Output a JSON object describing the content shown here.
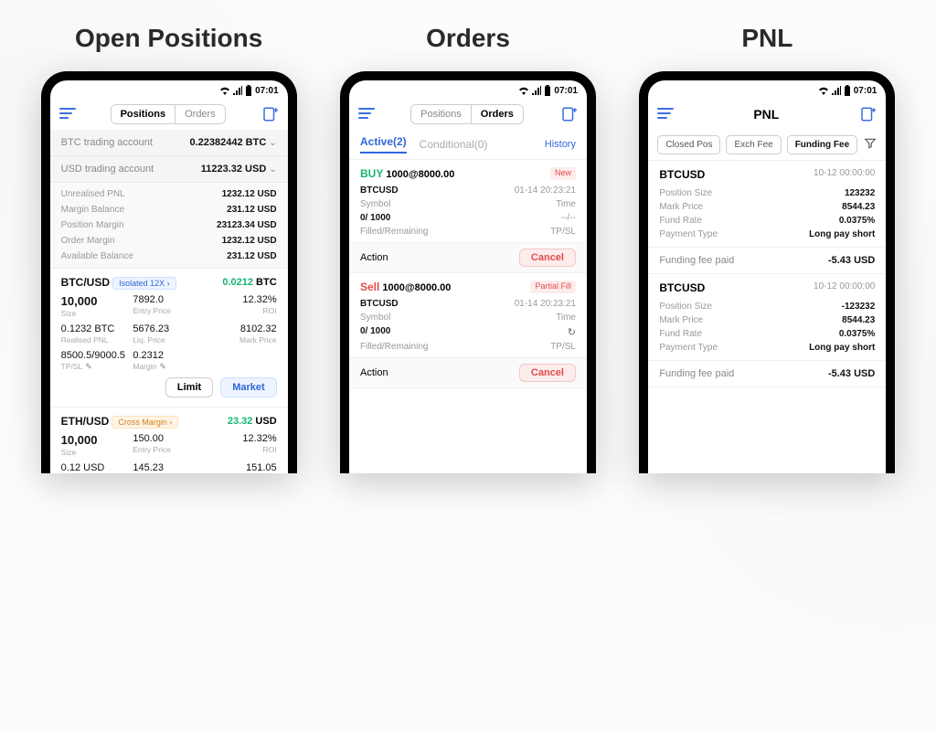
{
  "status_time": "07:01",
  "panels": {
    "positions": {
      "title": "Open Positions"
    },
    "orders": {
      "title": "Orders"
    },
    "pnl": {
      "title": "PNL"
    }
  },
  "header_tabs": {
    "positions": "Positions",
    "orders": "Orders"
  },
  "pnl_header_title": "PNL",
  "positions": {
    "accounts": {
      "btc": {
        "label": "BTC trading account",
        "value": "0.22382442 BTC"
      },
      "usd": {
        "label": "USD trading account",
        "value": "11223.32 USD"
      }
    },
    "summary": {
      "unrealised_pnl": {
        "k": "Unrealised PNL",
        "v": "1232.12 USD"
      },
      "margin_balance": {
        "k": "Margin Balance",
        "v": "231.12 USD"
      },
      "position_margin": {
        "k": "Position Margin",
        "v": "23123.34 USD"
      },
      "order_margin": {
        "k": "Order Margin",
        "v": "1232.12 USD"
      },
      "available_balance": {
        "k": "Available Balance",
        "v": "231.12 USD"
      }
    },
    "btns": {
      "limit": "Limit",
      "market": "Market"
    },
    "card_btc": {
      "pair": "BTC/USD",
      "pill": "Isolated 12X",
      "val": "0.0212",
      "val_unit": "BTC",
      "r1": {
        "size_v": "10,000",
        "size_k": "Size",
        "entry_v": "7892.0",
        "entry_k": "Entry Price",
        "roi_v": "12.32%",
        "roi_k": "ROI"
      },
      "r2": {
        "rp_v": "0.1232 BTC",
        "rp_k": "Realised PNL",
        "liq_v": "5676.23",
        "liq_k": "Liq. Price",
        "mp_v": "8102.32",
        "mp_k": "Mark Price"
      },
      "r3": {
        "tpsl_v": "8500.5/9000.5",
        "tpsl_k": "TP/SL",
        "margin_v": "0.2312",
        "margin_k": "Margin"
      }
    },
    "card_eth": {
      "pair": "ETH/USD",
      "pill": "Cross Margin",
      "val": "23.32",
      "val_unit": "USD",
      "r1": {
        "size_v": "10,000",
        "size_k": "Size",
        "entry_v": "150.00",
        "entry_k": "Entry Price",
        "roi_v": "12.32%",
        "roi_k": "ROI"
      },
      "r2": {
        "rp_v": "0.12 USD",
        "rp_k": "",
        "liq_v": "145.23",
        "liq_k": "",
        "mp_v": "151.05",
        "mp_k": ""
      }
    }
  },
  "orders": {
    "subtabs": {
      "active": "Active(2)",
      "conditional": "Conditional(0)",
      "history": "History"
    },
    "action_label": "Action",
    "cancel_label": "Cancel",
    "labels": {
      "symbol": "Symbol",
      "filled": "Filled/Remaining",
      "time": "Time",
      "tpsl": "TP/SL"
    },
    "o1": {
      "side": "BUY",
      "side_class": "side-buy",
      "qty": "1000@8000.00",
      "badge": "New",
      "badge_class": "new",
      "sym": "BTCUSD",
      "time": "01-14 20:23:21",
      "filled": "0/ 1000",
      "tpsl": "--/--"
    },
    "o2": {
      "side": "Sell",
      "side_class": "side-sell",
      "qty": "1000@8000.00",
      "badge": "Partial Fill",
      "badge_class": "partial",
      "sym": "BTCUSD",
      "time": "01-14 20:23:21",
      "filled": "0/ 1000",
      "tpsl": "--/--"
    }
  },
  "pnl": {
    "tabs": {
      "closed": "Closed Pos",
      "exch": "Exch Fee",
      "funding": "Funding Fee"
    },
    "labels": {
      "size": "Position Size",
      "mark": "Mark Price",
      "rate": "Fund Rate",
      "pay": "Payment Type"
    },
    "fee_label": "Funding fee paid",
    "c1": {
      "sym": "BTCUSD",
      "time": "10-12 00:00:00",
      "size": "123232",
      "mark": "8544.23",
      "rate": "0.0375%",
      "pay": "Long pay short",
      "fee": "-5.43 USD"
    },
    "c2": {
      "sym": "BTCUSD",
      "time": "10-12 00:00:00",
      "size": "-123232",
      "mark": "8544.23",
      "rate": "0.0375%",
      "pay": "Long pay short",
      "fee": "-5.43 USD"
    }
  }
}
